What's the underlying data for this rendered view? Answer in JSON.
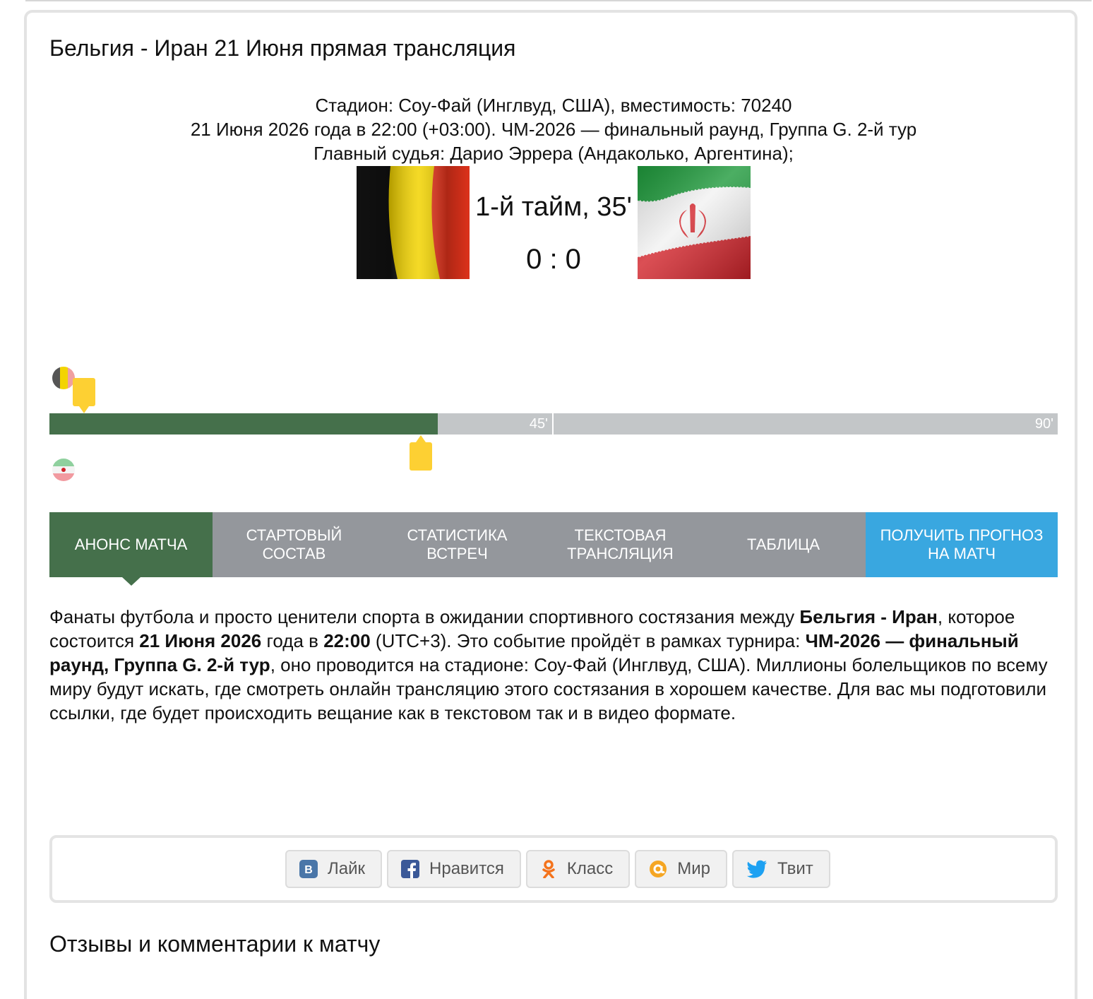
{
  "page": {
    "title": "Бельгия - Иран 21 Июня прямая трансляция"
  },
  "match": {
    "stadium_line": "Стадион: Соу-Фай (Инглвуд, США), вместимость: 70240",
    "date_line": "21 Июня 2026 года в 22:00 (+03:00). ЧМ-2026 — финальный раунд, Группа G. 2-й тур",
    "referee_line": "Главный судья: Дарио Эррера (Андаколько, Аргентина);",
    "status": "1-й тайм, 35'",
    "score": "0 : 0",
    "home_flag_icon": "belgium-flag",
    "away_flag_icon": "iran-flag"
  },
  "timeline": {
    "elapsed_minutes": 35,
    "total_minutes": 90,
    "half_label": "45'",
    "full_label": "90'",
    "elapsed_color": "#45704b",
    "remaining_color": "#c3c6c8",
    "marker_color": "#fdd033",
    "home_events": [
      {
        "minute": 3,
        "type": "yellow-card"
      }
    ],
    "away_events": [
      {
        "minute": 35,
        "type": "yellow-card"
      }
    ]
  },
  "tabs": [
    {
      "label": "Анонс матча",
      "active": true
    },
    {
      "label": "Стартовый состав"
    },
    {
      "label": "Статистика встреч"
    },
    {
      "label": "Текстовая трансляция"
    },
    {
      "label": "Таблица"
    },
    {
      "label": "Получить прогноз на матч"
    }
  ],
  "colors": {
    "active_tab": "#45704b",
    "tab": "#94979c",
    "forecast_tab": "#39a7e0"
  },
  "announce": {
    "p1": "Фанаты футбола и просто ценители спорта в ожидании спортивного состязания между ",
    "teams": "Бельгия - Иран",
    "p2": ", которое состоится ",
    "date": "21 Июня 2026",
    "p3": " года в ",
    "time": "22:00",
    "p4": " (UTC+3). Это событие пройдёт в рамках турнира: ",
    "tournament": "ЧМ-2026 — финальный раунд, Группа G. 2-й тур",
    "p5": ", оно проводится на стадионе: Соу-Фай (Инглвуд, США). Миллионы болельщиков по всему миру будут искать, где смотреть онлайн трансляцию этого состязания в хорошем качестве. Для вас мы подготовили ссылки, где будет происходить вещание как в текстовом так и в видео формате."
  },
  "share": [
    {
      "label": "Лайк",
      "icon": "vk-icon"
    },
    {
      "label": "Нравится",
      "icon": "facebook-icon"
    },
    {
      "label": "Класс",
      "icon": "odnoklassniki-icon"
    },
    {
      "label": "Мир",
      "icon": "mailru-icon"
    },
    {
      "label": "Твит",
      "icon": "twitter-icon"
    }
  ],
  "comments": {
    "title": "Отзывы и комментарии к матчу"
  }
}
